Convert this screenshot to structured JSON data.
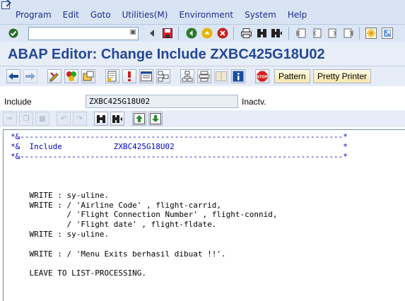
{
  "menubar": {
    "items": [
      "Program",
      "Edit",
      "Goto",
      "Utilities(M)",
      "Environment",
      "System",
      "Help"
    ]
  },
  "systoolbar": {
    "command_value": "",
    "icons": [
      "enter-icon",
      "save-icon",
      "back-icon",
      "exit-icon",
      "cancel-icon",
      "print-icon",
      "find-icon",
      "find-next-icon",
      "first-page-icon",
      "prev-page-icon",
      "next-page-icon",
      "last-page-icon",
      "new-session-icon",
      "shortcut-icon"
    ]
  },
  "title": "ABAP Editor: Change Include ZXBC425G18U02",
  "apptoolbar": {
    "pattern_label": "Pattern",
    "pretty_printer_label": "Pretty Printer"
  },
  "include": {
    "label": "Include",
    "value": "ZXBC425G18U02",
    "status": "Inactv."
  },
  "editor": {
    "lines": [
      {
        "text": "*&---------------------------------------------------------------------*",
        "type": "comment"
      },
      {
        "text": "*&  Include           ZXBC425G18U02                                    *",
        "type": "comment"
      },
      {
        "text": "*&---------------------------------------------------------------------*",
        "type": "comment"
      },
      {
        "text": "",
        "type": "code"
      },
      {
        "text": "",
        "type": "code"
      },
      {
        "text": "",
        "type": "code"
      },
      {
        "text": "    WRITE : sy-uline.",
        "type": "code"
      },
      {
        "text": "    WRITE : / 'Airline Code' , flight-carrid,",
        "type": "code"
      },
      {
        "text": "            / 'Flight Connection Number' , flight-connid,",
        "type": "code"
      },
      {
        "text": "            / 'Flight date' , flight-fldate.",
        "type": "code"
      },
      {
        "text": "    WRITE : sy-uline.",
        "type": "code"
      },
      {
        "text": "",
        "type": "code"
      },
      {
        "text": "    WRITE : / 'Menu Exits berhasil dibuat !!'.",
        "type": "code"
      },
      {
        "text": "",
        "type": "code"
      },
      {
        "text": "    LEAVE TO LIST-PROCESSING.",
        "type": "code"
      }
    ]
  },
  "colors": {
    "title": "#24479a",
    "menu_text": "#1c2c90",
    "comment": "#0000c8"
  }
}
